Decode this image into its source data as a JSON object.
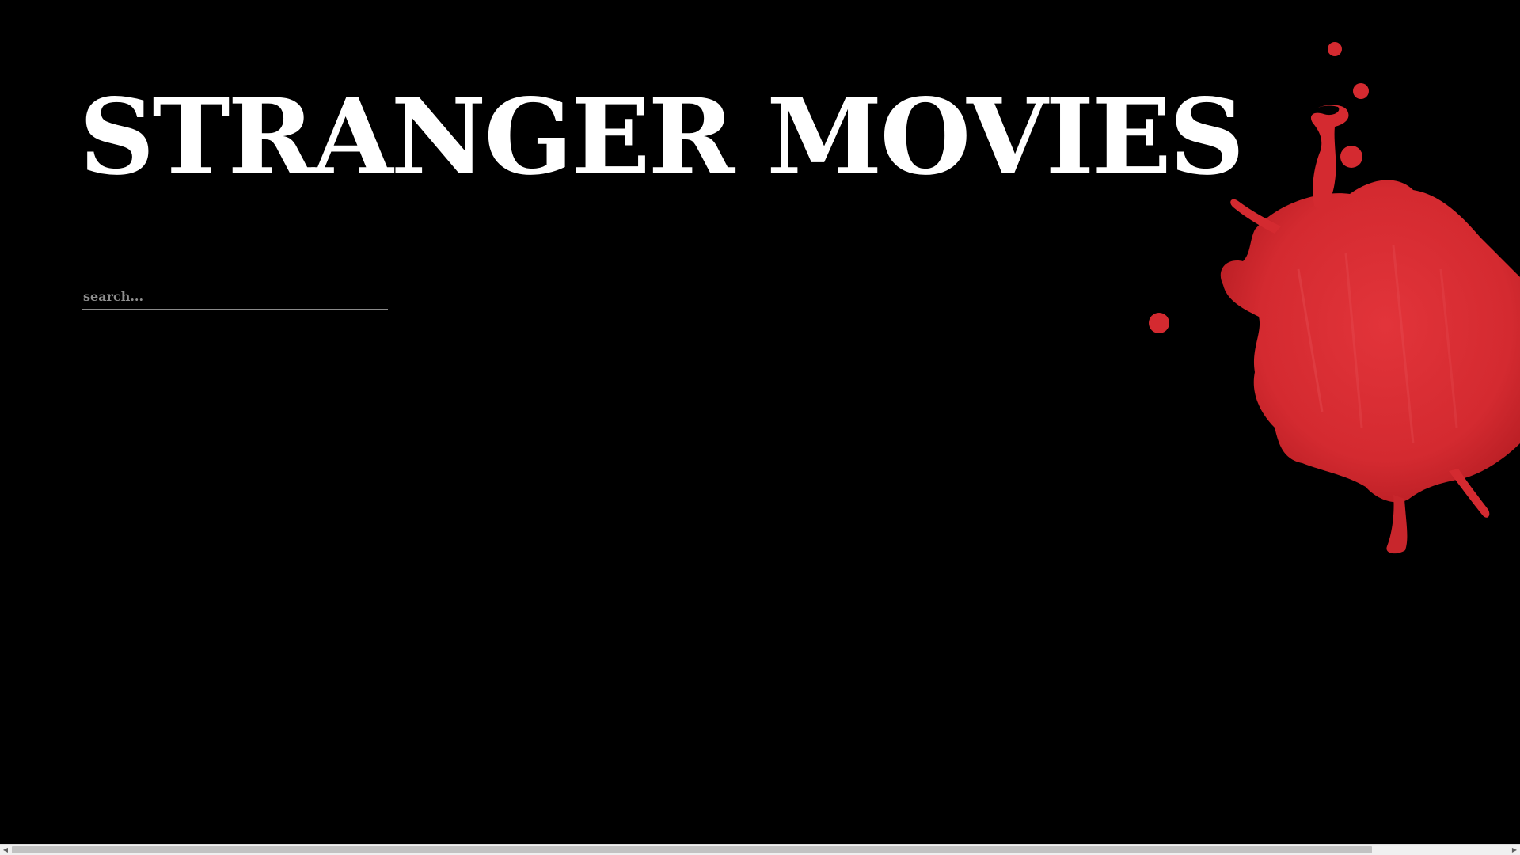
{
  "header": {
    "title": "STRANGER MOVIES"
  },
  "search": {
    "placeholder": "search...",
    "value": ""
  },
  "decoration": {
    "splatter_icon": "blood-splatter-icon",
    "splatter_color": "#d9262c"
  },
  "scrollbar": {
    "left_arrow_icon": "chevron-left-icon",
    "right_arrow_icon": "chevron-right-icon",
    "left_arrow_glyph": "◀",
    "right_arrow_glyph": "▶"
  },
  "colors": {
    "background": "#000000",
    "title": "#ffffff",
    "search_text": "#8f8f8f",
    "search_underline": "#8a8a8a"
  }
}
